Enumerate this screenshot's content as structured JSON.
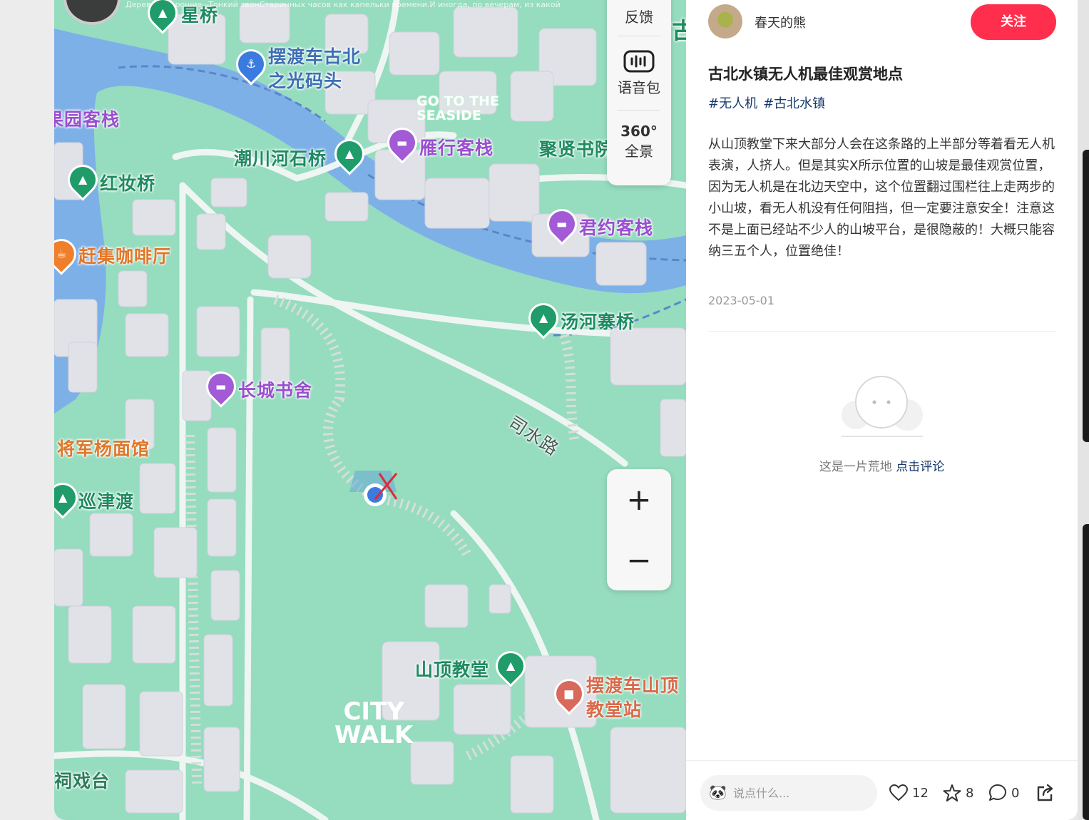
{
  "map": {
    "overlay_text": "Дерева... хорошие –Тонкий звонСтаринных часов как капельки времени.И иногда, по вечерам, из какой",
    "labels": {
      "xing_bridge": "星桥",
      "ferry_gubei_1": "摆渡车古北",
      "ferry_gubei_2": "之光码头",
      "guoyuan_inn": "果园客栈",
      "chaochuan_bridge": "潮川河石桥",
      "yanxing_inn": "雁行客栈",
      "juxian": "聚贤书院",
      "hongzhuang_bridge": "红妆桥",
      "junyue_inn": "君约客栈",
      "ganji_cafe": "赶集咖啡厅",
      "tanghe_bridge": "汤河寨桥",
      "changcheng_shushe": "长城书舍",
      "jiangjun_noodle": "将军杨面馆",
      "xunjin_ferry": "巡津渡",
      "sishui_road": "司水路",
      "shanding_church": "山顶教堂",
      "ferry_church_1": "摆渡车山顶",
      "ferry_church_2": "教堂站",
      "xitai": "祠戏台",
      "gu": "古",
      "seaside_1": "GO TO THE",
      "seaside_2": "SEASIDE",
      "city": "CITY",
      "walk": "WALK"
    },
    "controls": {
      "feedback": "反馈",
      "voice_pack": "语音包",
      "panorama_badge": "360°",
      "panorama": "全景",
      "zoom_in": "+",
      "zoom_out": "−"
    }
  },
  "post": {
    "author": "春天的熊",
    "follow_label": "关注",
    "title": "古北水镇无人机最佳观赏地点",
    "tags": [
      "#无人机",
      "#古北水镇"
    ],
    "body": "从山顶教堂下来大部分人会在这条路的上半部分等着看无人机表演，人挤人。但是其实X所示位置的山坡是最佳观赏位置，因为无人机是在北边天空中，这个位置翻过围栏往上走两步的小山坡，看无人机没有任何阻挡，但一定要注意安全！注意这不是上面已经站不少人的山坡平台，是很隐蔽的！大概只能容纳三五个人，位置绝佳！",
    "date": "2023-05-01",
    "empty_comments": "这是一片荒地",
    "comment_link": "点击评论"
  },
  "bottom_bar": {
    "placeholder": "说点什么...",
    "likes": "12",
    "collects": "8",
    "comments": "0"
  },
  "colors": {
    "accent": "#ff2e4d",
    "link": "#13386c",
    "map_green": "#96dcbf",
    "river": "#7eb0e8"
  }
}
